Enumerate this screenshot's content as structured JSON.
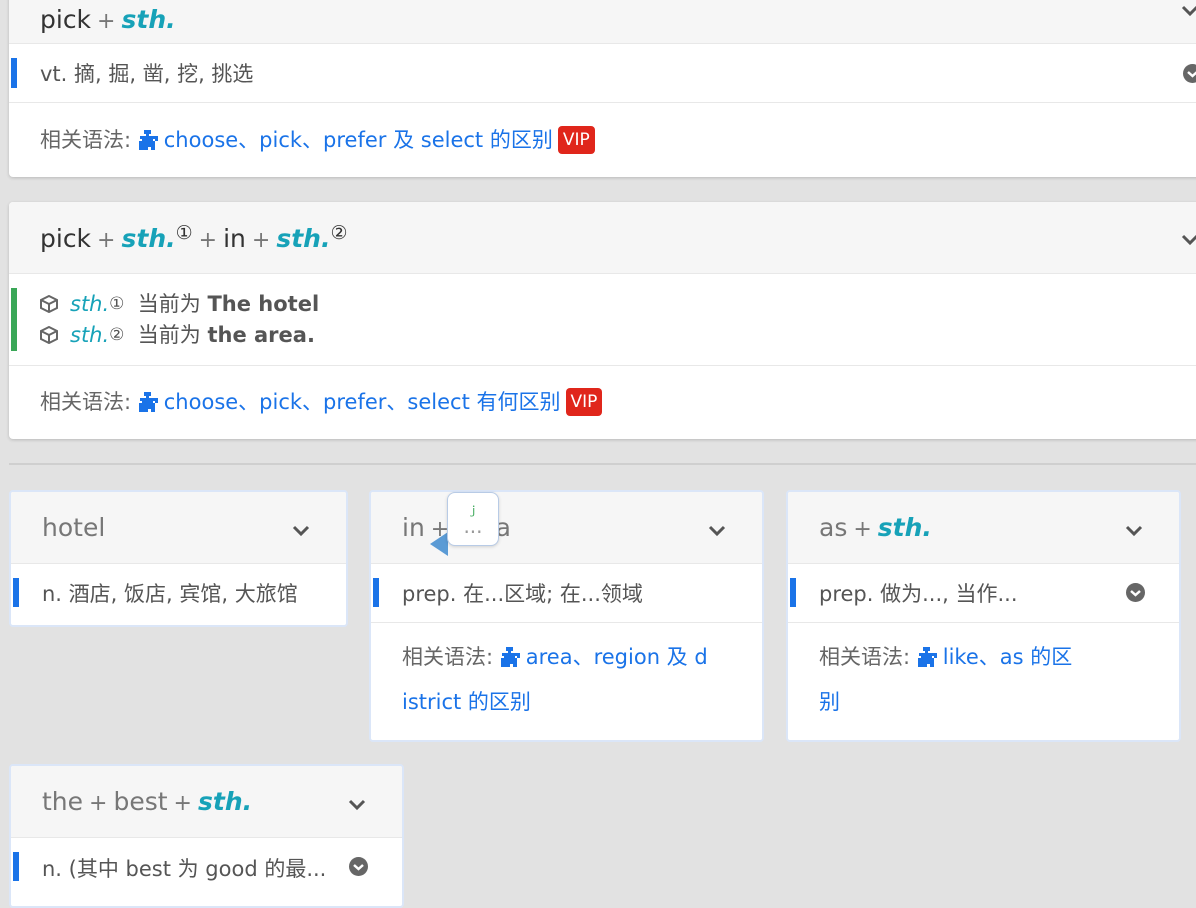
{
  "card1": {
    "pattern": {
      "w1": "pick",
      "plus1": "+",
      "sth": "sth."
    },
    "definition": "vt. 摘, 掘, 凿, 挖, 挑选",
    "related_label": "相关语法: ",
    "related_link": "choose、pick、prefer 及 select 的区别",
    "vip": "VIP"
  },
  "card2": {
    "pattern": {
      "w1": "pick",
      "plus1": "+",
      "sth1": "sth.",
      "sup1": "①",
      "plus2": "+",
      "w2": "in",
      "plus3": "+",
      "sth2": "sth.",
      "sup2": "②"
    },
    "slots": [
      {
        "sth": "sth.",
        "sup": "①",
        "prefix": "当前为",
        "value": "The hotel"
      },
      {
        "sth": "sth.",
        "sup": "②",
        "prefix": "当前为",
        "value": "the area."
      }
    ],
    "related_label": "相关语法: ",
    "related_link": "choose、pick、prefer、select 有何区别",
    "vip": "VIP"
  },
  "hotel": {
    "word": "hotel",
    "definition": "n. 酒店, 饭店, 宾馆, 大旅馆"
  },
  "in_area": {
    "w1": "in",
    "plus1": "+",
    "w2": "area",
    "definition": "prep. 在...区域; 在...领域",
    "related_label": "相关语法: ",
    "related_link_1": "area、region 及 d",
    "related_link_2": "istrict 的区别"
  },
  "as_sth": {
    "w1": "as",
    "plus1": "+",
    "sth": "sth.",
    "definition": "prep. 做为..., 当作...",
    "related_label": "相关语法: ",
    "related_link_1": "like、as 的区",
    "related_link_2": "别"
  },
  "the_best": {
    "w1": "the",
    "plus1": "+",
    "w2": "best",
    "plus2": "+",
    "sth": "sth.",
    "definition": "n. (其中 best 为 good 的最..."
  },
  "tooltip": {
    "mark": "ｊ",
    "ellipsis": "..."
  },
  "colors": {
    "accent_blue": "#1a73e8",
    "accent_green": "#3aa757",
    "sth_teal": "#17a2b8",
    "vip_red": "#e0261b"
  }
}
